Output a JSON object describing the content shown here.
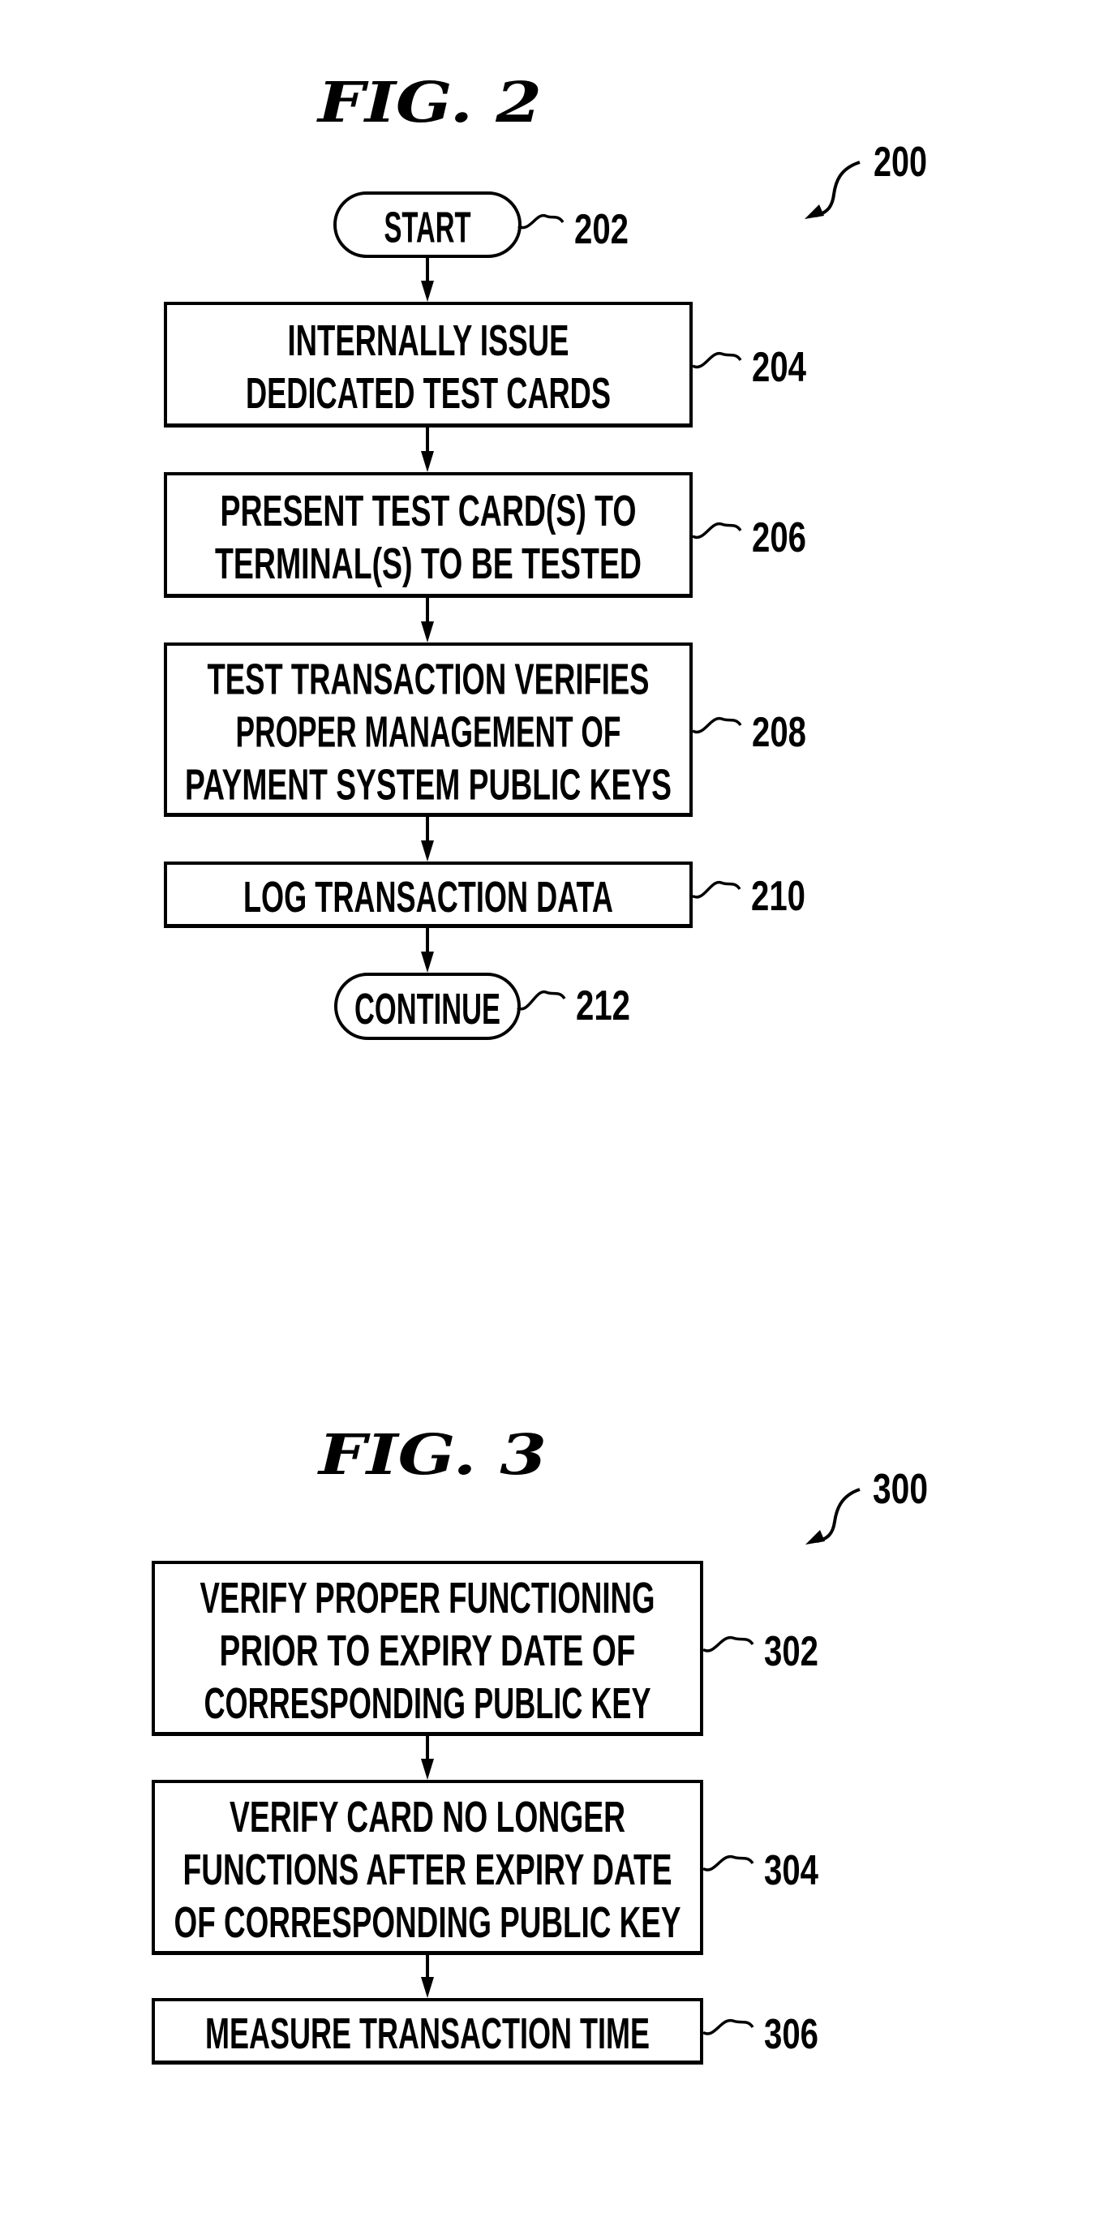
{
  "figures": [
    {
      "id": "fig2",
      "title": "FIG.  2",
      "reference": "200",
      "nodes": [
        {
          "ref": "202",
          "kind": "terminal",
          "lines": [
            "START"
          ]
        },
        {
          "ref": "204",
          "kind": "process",
          "lines": [
            "INTERNALLY ISSUE",
            "DEDICATED TEST CARDS"
          ]
        },
        {
          "ref": "206",
          "kind": "process",
          "lines": [
            "PRESENT TEST CARD(S) TO",
            "TERMINAL(S) TO BE TESTED"
          ]
        },
        {
          "ref": "208",
          "kind": "process",
          "lines": [
            "TEST TRANSACTION VERIFIES",
            "PROPER MANAGEMENT OF",
            "PAYMENT SYSTEM PUBLIC KEYS"
          ]
        },
        {
          "ref": "210",
          "kind": "process",
          "lines": [
            "LOG TRANSACTION DATA"
          ]
        },
        {
          "ref": "212",
          "kind": "terminal",
          "lines": [
            "CONTINUE"
          ]
        }
      ]
    },
    {
      "id": "fig3",
      "title": "FIG.  3",
      "reference": "300",
      "nodes": [
        {
          "ref": "302",
          "kind": "process",
          "lines": [
            "VERIFY PROPER FUNCTIONING",
            "PRIOR TO EXPIRY DATE OF",
            "CORRESPONDING PUBLIC KEY"
          ]
        },
        {
          "ref": "304",
          "kind": "process",
          "lines": [
            "VERIFY CARD NO LONGER",
            "FUNCTIONS AFTER EXPIRY DATE",
            "OF CORRESPONDING PUBLIC KEY"
          ]
        },
        {
          "ref": "306",
          "kind": "process",
          "lines": [
            "MEASURE TRANSACTION TIME"
          ]
        }
      ]
    }
  ],
  "colors": {
    "ink": "#000000",
    "paper": "#ffffff"
  }
}
